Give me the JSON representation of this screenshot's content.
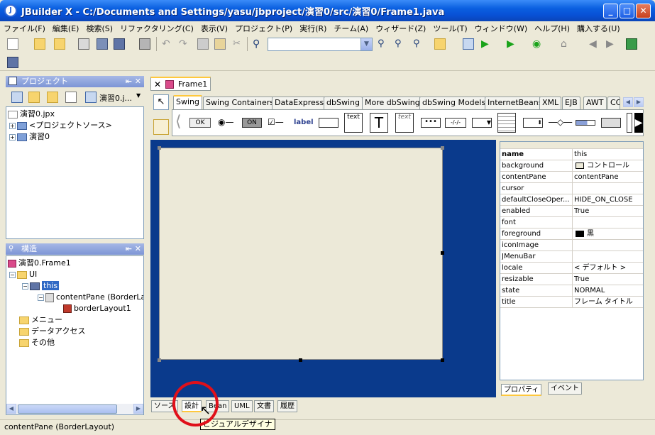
{
  "window": {
    "title": "JBuilder X - C:/Documents and Settings/yasu/jbproject/演習0/src/演習0/Frame1.java",
    "icon_letter": "J"
  },
  "menu": [
    "ファイル(F)",
    "編集(E)",
    "検索(S)",
    "リファクタリング(C)",
    "表示(V)",
    "プロジェクト(P)",
    "実行(R)",
    "チーム(A)",
    "ウィザード(Z)",
    "ツール(T)",
    "ウィンドウ(W)",
    "ヘルプ(H)",
    "購入する(U)"
  ],
  "toolbar": {
    "search_value": ""
  },
  "project_panel": {
    "title": "プロジェクト",
    "selector": "演習0.j...",
    "tree": [
      "演習0.jpx",
      "<プロジェクトソース>",
      "演習0"
    ]
  },
  "structure_panel": {
    "title": "構造",
    "tree": [
      "演習0.Frame1",
      "UI",
      "this",
      "contentPane (BorderLay",
      "borderLayout1",
      "メニュー",
      "データアクセス",
      "その他"
    ]
  },
  "editor_tab": "Frame1",
  "palette": {
    "tabs": [
      "Swing",
      "Swing Containers",
      "DataExpress",
      "dbSwing",
      "More dbSwing",
      "dbSwing Models",
      "InternetBeans",
      "XML",
      "EJB",
      "AWT",
      "CC"
    ],
    "active": "Swing",
    "components": [
      "OK",
      "ON",
      "label",
      "text",
      "T",
      "text"
    ]
  },
  "inspector": {
    "rows": [
      {
        "name": "name",
        "value": "this",
        "bold": true
      },
      {
        "name": "background",
        "value": "コントロール",
        "swatch": "#ece9d8"
      },
      {
        "name": "contentPane",
        "value": "contentPane"
      },
      {
        "name": "cursor",
        "value": ""
      },
      {
        "name": "defaultCloseOper...",
        "value": "HIDE_ON_CLOSE"
      },
      {
        "name": "enabled",
        "value": "True"
      },
      {
        "name": "font",
        "value": ""
      },
      {
        "name": "foreground",
        "value": "黒",
        "swatch": "#000000"
      },
      {
        "name": "iconImage",
        "value": ""
      },
      {
        "name": "JMenuBar",
        "value": ""
      },
      {
        "name": "locale",
        "value": "< デフォルト >"
      },
      {
        "name": "resizable",
        "value": "True"
      },
      {
        "name": "state",
        "value": "NORMAL"
      },
      {
        "name": "title",
        "value": "フレーム タイトル"
      }
    ],
    "tabs": [
      "プロパティ",
      "イベント"
    ]
  },
  "bottom_tabs": [
    "ソース",
    "設計",
    "Bean",
    "UML",
    "文書",
    "履歴"
  ],
  "tooltip": "ビジュアルデザイナ",
  "status": "contentPane (BorderLayout)",
  "colors": {
    "designer_bg": "#0a3a8c",
    "highlight": "#e0101a",
    "titlebar": "#0851d6"
  }
}
